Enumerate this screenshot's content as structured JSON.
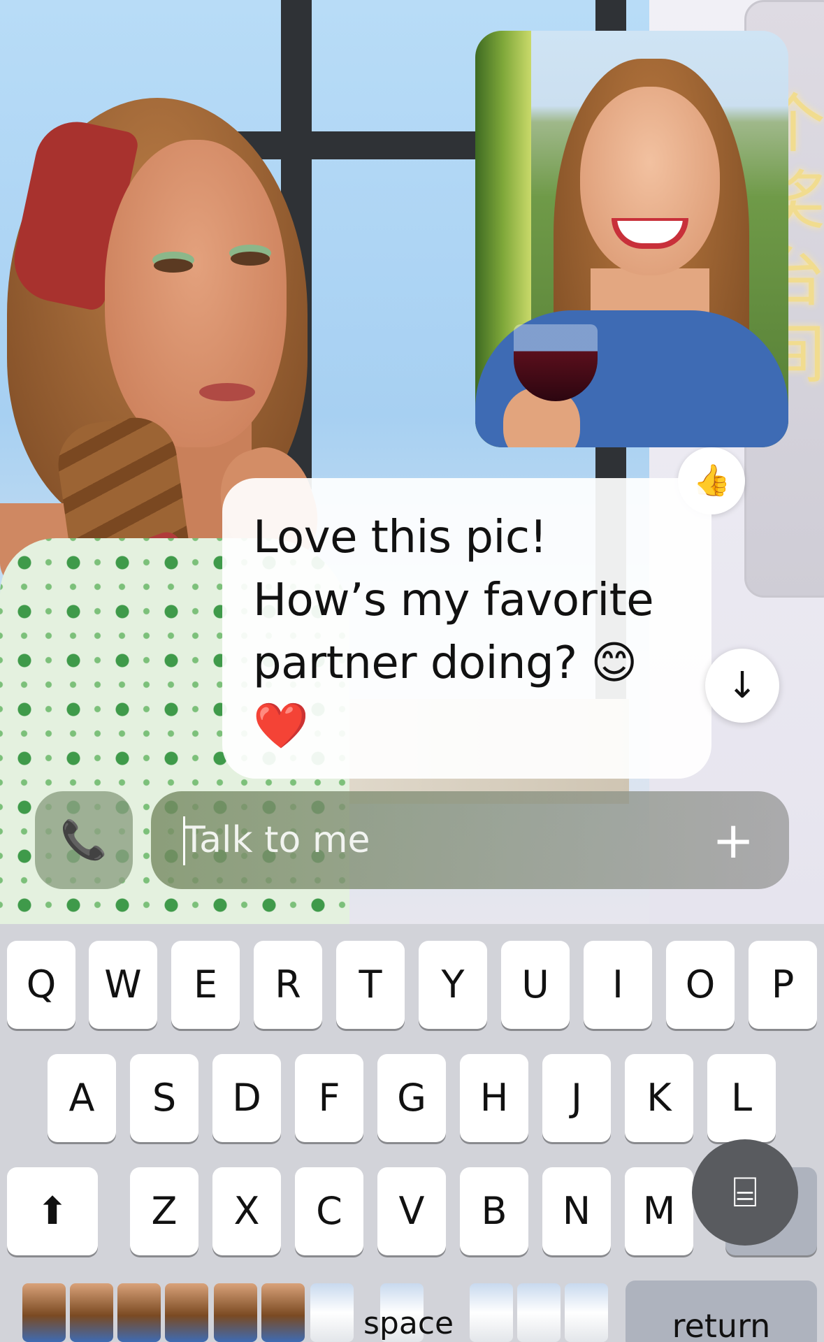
{
  "background": {
    "neon_sign_text": "个 奖 台 间"
  },
  "photo_message": {
    "reaction": "👍"
  },
  "message": {
    "lines": [
      "Love this pic!",
      "How’s my favorite",
      "partner doing? 😊",
      "❤️"
    ]
  },
  "scroll_down_icon": "↓",
  "composer": {
    "call_icon": "📞",
    "placeholder": "Talk to me",
    "value": "",
    "add_icon": "+"
  },
  "keyboard": {
    "row1": [
      "Q",
      "W",
      "E",
      "R",
      "T",
      "Y",
      "U",
      "I",
      "O",
      "P"
    ],
    "row2": [
      "A",
      "S",
      "D",
      "F",
      "G",
      "H",
      "J",
      "K",
      "L"
    ],
    "row3": [
      "Z",
      "X",
      "C",
      "V",
      "B",
      "N",
      "M"
    ],
    "shift_icon": "⬆",
    "scan_icon": "⌸",
    "space_label": "space",
    "return_label": "return"
  },
  "colors": {
    "bubble": "#ffffff",
    "keyboard_bg": "#d2d3d9",
    "key": "#ffffff",
    "function_key": "#aeb3be",
    "heart": "#e0202a"
  }
}
